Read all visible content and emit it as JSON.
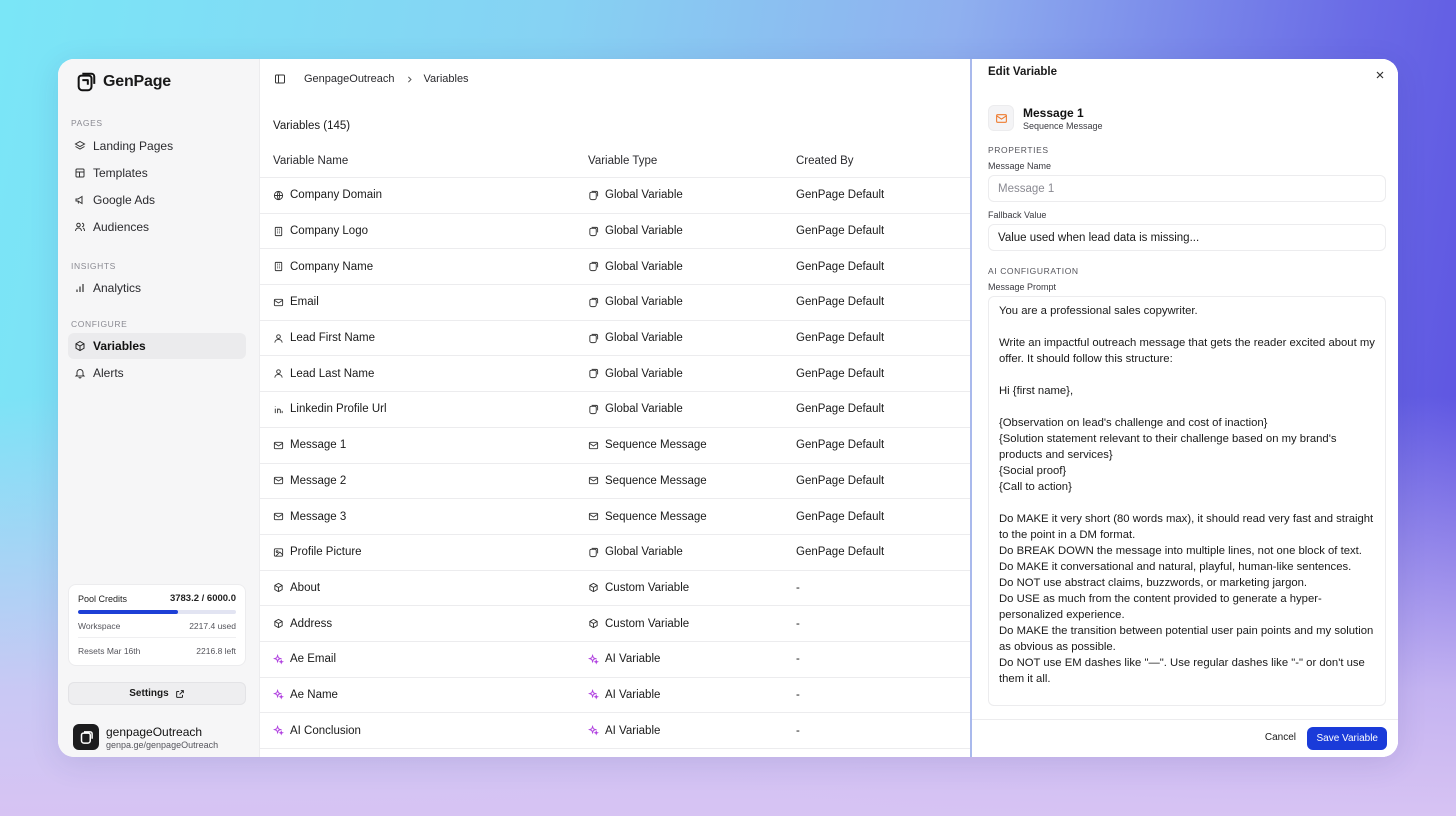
{
  "brand": {
    "name": "GenPage"
  },
  "sidebar": {
    "sections": {
      "pages": "PAGES",
      "insights": "INSIGHTS",
      "configure": "CONFIGURE"
    },
    "items": [
      {
        "label": "Landing Pages",
        "icon": "layers-icon"
      },
      {
        "label": "Templates",
        "icon": "layout-icon"
      },
      {
        "label": "Google Ads",
        "icon": "megaphone-icon"
      },
      {
        "label": "Audiences",
        "icon": "users-icon"
      },
      {
        "label": "Analytics",
        "icon": "bar-chart-icon"
      },
      {
        "label": "Variables",
        "icon": "cube-icon",
        "active": true
      },
      {
        "label": "Alerts",
        "icon": "bell-icon"
      }
    ],
    "credits": {
      "pool_label": "Pool Credits",
      "pool_value": "3783.2 / 6000.0",
      "progress": 0.63,
      "workspace_label": "Workspace",
      "workspace_value": "2217.4 used",
      "resets_label": "Resets Mar 16th",
      "resets_value": "2216.8 left"
    },
    "settings_label": "Settings",
    "account": {
      "name": "genpageOutreach",
      "url": "genpa.ge/genpageOutreach"
    }
  },
  "breadcrumb": {
    "workspace": "GenpageOutreach",
    "current": "Variables"
  },
  "table": {
    "title": "Variables (145)",
    "columns": [
      "Variable Name",
      "Variable Type",
      "Created By"
    ],
    "rows": [
      {
        "name": "Company Domain",
        "type": "Global Variable",
        "created": "GenPage Default"
      },
      {
        "name": "Company Logo",
        "type": "Global Variable",
        "created": "GenPage Default"
      },
      {
        "name": "Company Name",
        "type": "Global Variable",
        "created": "GenPage Default"
      },
      {
        "name": "Email",
        "type": "Global Variable",
        "created": "GenPage Default"
      },
      {
        "name": "Lead First Name",
        "type": "Global Variable",
        "created": "GenPage Default"
      },
      {
        "name": "Lead Last Name",
        "type": "Global Variable",
        "created": "GenPage Default"
      },
      {
        "name": "Linkedin Profile Url",
        "type": "Global Variable",
        "created": "GenPage Default"
      },
      {
        "name": "Message 1",
        "type": "Sequence Message",
        "created": "GenPage Default"
      },
      {
        "name": "Message 2",
        "type": "Sequence Message",
        "created": "GenPage Default"
      },
      {
        "name": "Message 3",
        "type": "Sequence Message",
        "created": "GenPage Default"
      },
      {
        "name": "Profile Picture",
        "type": "Global Variable",
        "created": "GenPage Default"
      },
      {
        "name": "About",
        "type": "Custom Variable",
        "created": "-"
      },
      {
        "name": "Address",
        "type": "Custom Variable",
        "created": "-"
      },
      {
        "name": "Ae Email",
        "type": "AI Variable",
        "created": "-"
      },
      {
        "name": "Ae Name",
        "type": "AI Variable",
        "created": "-"
      },
      {
        "name": "AI Conclusion",
        "type": "AI Variable",
        "created": "-"
      }
    ]
  },
  "panel": {
    "title": "Edit Variable",
    "message_title": "Message 1",
    "message_subtitle": "Sequence Message",
    "properties_label": "PROPERTIES",
    "message_name_label": "Message Name",
    "message_name_placeholder": "Message 1",
    "fallback_label": "Fallback Value",
    "fallback_value": "Value used when lead data is missing...",
    "ai_config_label": "AI CONFIGURATION",
    "prompt_label": "Message Prompt",
    "prompt_text": "You are a professional sales copywriter.\n\nWrite an impactful outreach message that gets the reader excited about my offer. It should follow this structure:\n\nHi {first name},\n\n{Observation on lead's challenge and cost of inaction}\n{Solution statement relevant to their challenge based on my brand's products and services}\n{Social proof}\n{Call to action}\n\nDo MAKE it very short (80 words max), it should read very fast and straight to the point in a DM format.\nDo BREAK DOWN the message into multiple lines, not one block of text.\nDo MAKE it conversational and natural, playful, human-like sentences.\nDo NOT use abstract claims, buzzwords, or marketing jargon.\nDo USE as much from the content provided to generate a hyper-personalized experience.\nDo MAKE the transition between potential user pain points and my solution as obvious as possible.\nDo NOT use EM dashes like \"—\". Use regular dashes like \"-\" or don't use them it all.",
    "cancel_label": "Cancel",
    "save_label": "Save Variable"
  },
  "colors": {
    "accent": "#1a3bd9",
    "ai_icon": "#b040e0",
    "mail_orange": "#ee7b2f"
  }
}
